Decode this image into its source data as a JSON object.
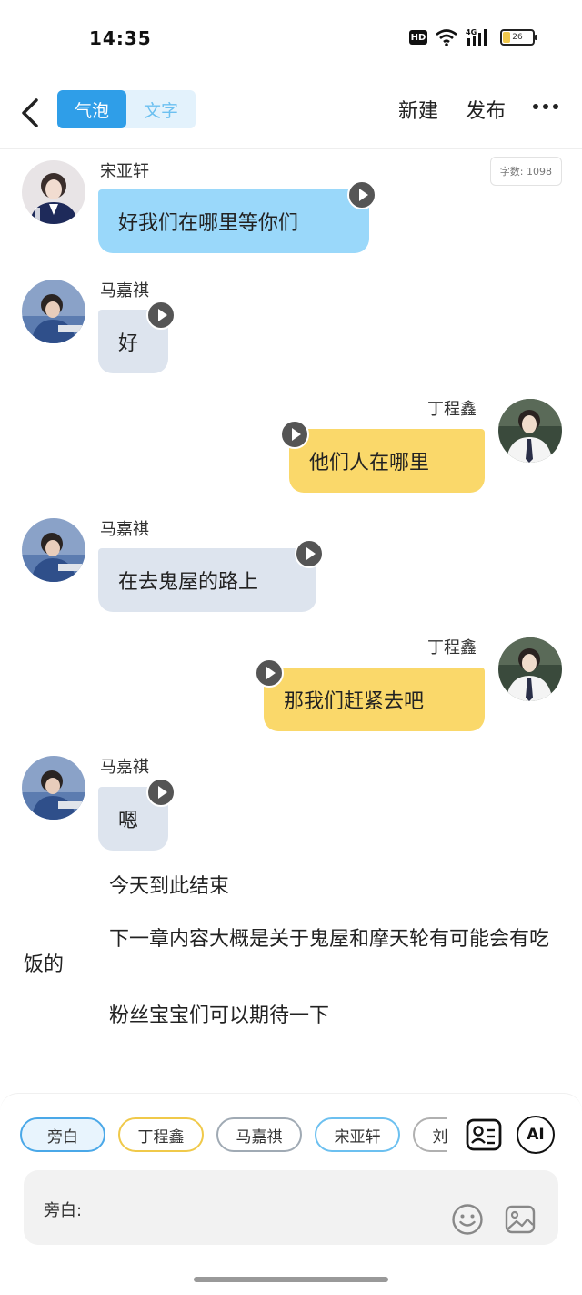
{
  "status_bar": {
    "time": "14:35",
    "network": "4G",
    "hd": "HD",
    "battery": "26"
  },
  "header": {
    "tabs": [
      {
        "label": "气泡",
        "active": true
      },
      {
        "label": "文字",
        "active": false
      }
    ],
    "new_label": "新建",
    "publish_label": "发布"
  },
  "word_count": "字数: 1098",
  "messages": [
    {
      "speaker": "宋亚轩",
      "text": "好我们在哪里等你们",
      "side": "left"
    },
    {
      "speaker": "马嘉祺",
      "text": "好",
      "side": "left"
    },
    {
      "speaker": "丁程鑫",
      "text": "他们人在哪里",
      "side": "right"
    },
    {
      "speaker": "马嘉祺",
      "text": "在去鬼屋的路上",
      "side": "left"
    },
    {
      "speaker": "丁程鑫",
      "text": "那我们赶紧去吧",
      "side": "right"
    },
    {
      "speaker": "马嘉祺",
      "text": "嗯",
      "side": "left"
    }
  ],
  "narration": [
    "今天到此结束",
    "下一章内容大概是关于鬼屋和摩天轮有可能会有吃饭的",
    "粉丝宝宝们可以期待一下"
  ],
  "composer": {
    "chips": [
      "旁白",
      "丁程鑫",
      "马嘉祺",
      "宋亚轩",
      "刘耀文"
    ],
    "selected_chip": "旁白",
    "ai_label": "AI",
    "input_label": "旁白:"
  },
  "colors": {
    "accent": "#2f9ee8",
    "bubble_blue": "#9ad8fa",
    "bubble_gray": "#dde4ee",
    "bubble_yellow": "#fad86a"
  }
}
